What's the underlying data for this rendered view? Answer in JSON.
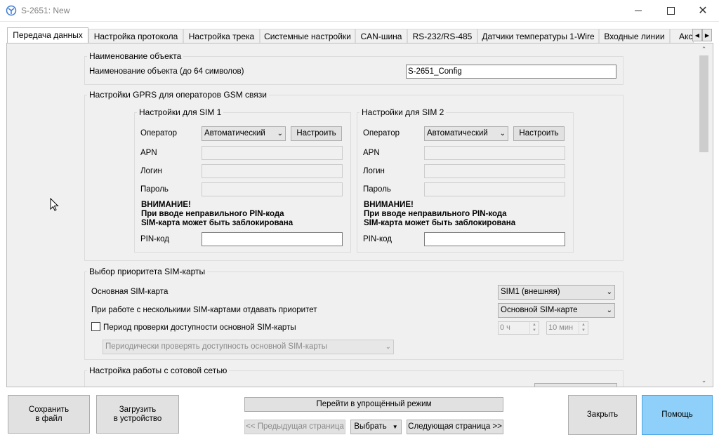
{
  "window": {
    "title": "S-2651: New",
    "icon": "satellite-app-icon"
  },
  "tabs": [
    {
      "label": "Передача данных",
      "active": true
    },
    {
      "label": "Настройка протокола"
    },
    {
      "label": "Настройка трека"
    },
    {
      "label": "Системные настройки"
    },
    {
      "label": "CAN-шина"
    },
    {
      "label": "RS-232/RS-485"
    },
    {
      "label": "Датчики температуры 1-Wire"
    },
    {
      "label": "Входные линии"
    },
    {
      "label": "Акс"
    }
  ],
  "object": {
    "group_title": "Наименование объекта",
    "label": "Наименование объекта (до 64 символов)",
    "value": "S-2651_Config"
  },
  "gprs": {
    "group_title": "Настройки GPRS для операторов GSM связи",
    "sim1": {
      "title": "Настройки для SIM 1",
      "operator_label": "Оператор",
      "operator_value": "Автоматический",
      "configure": "Настроить",
      "apn_label": "APN",
      "login_label": "Логин",
      "password_label": "Пароль",
      "warning": [
        "ВНИМАНИЕ!",
        "При вводе неправильного PIN-кода",
        "SIM-карта может быть заблокирована"
      ],
      "pin_label": "PIN-код"
    },
    "sim2": {
      "title": "Настройки для SIM 2",
      "operator_label": "Оператор",
      "operator_value": "Автоматический",
      "configure": "Настроить",
      "apn_label": "APN",
      "login_label": "Логин",
      "password_label": "Пароль",
      "warning": [
        "ВНИМАНИЕ!",
        "При вводе неправильного PIN-кода",
        "SIM-карта может быть заблокирована"
      ],
      "pin_label": "PIN-код"
    }
  },
  "priority": {
    "group_title": "Выбор приоритета SIM-карты",
    "main_sim_label": "Основная SIM-карта",
    "main_sim_value": "SIM1 (внешняя)",
    "multi_label": "При работе с несколькими SIM-картами отдавать приоритет",
    "multi_value": "Основной SIM-карте",
    "check_label": "Период проверки доступности основной SIM-карты",
    "hours_value": "0 ч",
    "minutes_value": "10 мин",
    "periodic_value": "Периодически проверять доступность основной SIM-карты"
  },
  "cellular": {
    "group_title": "Настройка работы с сотовой сетью"
  },
  "bottom": {
    "save": [
      "Сохранить",
      "в файл"
    ],
    "upload": [
      "Загрузить",
      "в устройство"
    ],
    "simple_mode": "Перейти в упрощённый режим",
    "prev": "<< Предыдущая страница",
    "choose": "Выбрать",
    "next": "Следующая страница >>",
    "close": "Закрыть",
    "help": "Помощь"
  }
}
